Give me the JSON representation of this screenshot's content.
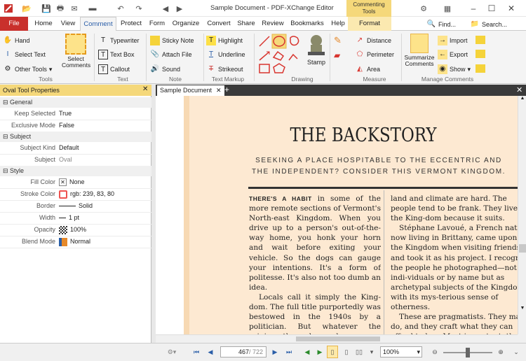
{
  "titlebar": {
    "title": "Sample Document - PDF-XChange Editor",
    "context_tab": "Commenting Tools",
    "find": "Find...",
    "search": "Search..."
  },
  "tabs": [
    "File",
    "Home",
    "View",
    "Comment",
    "Protect",
    "Form",
    "Organize",
    "Convert",
    "Share",
    "Review",
    "Bookmarks",
    "Help",
    "Format"
  ],
  "ribbon": {
    "tools": {
      "hand": "Hand",
      "select_text": "Select Text",
      "other_tools": "Other Tools",
      "select_comments": "Select Comments",
      "group": "Tools"
    },
    "text": {
      "typewriter": "Typewriter",
      "text_box": "Text Box",
      "callout": "Callout",
      "group": "Text"
    },
    "note": {
      "sticky_note": "Sticky Note",
      "attach_file": "Attach File",
      "sound": "Sound",
      "group": "Note"
    },
    "markup": {
      "highlight": "Highlight",
      "underline": "Underline",
      "strikeout": "Strikeout",
      "group": "Text Markup"
    },
    "drawing": {
      "stamp": "Stamp",
      "group": "Drawing"
    },
    "measure": {
      "distance": "Distance",
      "perimeter": "Perimeter",
      "area": "Area",
      "group": "Measure"
    },
    "manage": {
      "summarize": "Summarize Comments",
      "import": "Import",
      "export": "Export",
      "show": "Show",
      "group": "Manage Comments"
    }
  },
  "panel": {
    "title": "Oval Tool Properties",
    "sections": [
      {
        "name": "General",
        "rows": [
          {
            "label": "Keep Selected",
            "value": "True"
          },
          {
            "label": "Exclusive Mode",
            "value": "False"
          }
        ]
      },
      {
        "name": "Subject",
        "rows": [
          {
            "label": "Subject Kind",
            "value": "Default"
          },
          {
            "label": "Subject",
            "value": "Oval"
          }
        ]
      },
      {
        "name": "Style",
        "rows": [
          {
            "label": "Fill Color",
            "value": "None"
          },
          {
            "label": "Stroke Color",
            "value": "rgb: 239, 83, 80"
          },
          {
            "label": "Border",
            "value": "Solid"
          },
          {
            "label": "Width",
            "value": "1 pt"
          },
          {
            "label": "Opacity",
            "value": "100%"
          },
          {
            "label": "Blend Mode",
            "value": "Normal"
          }
        ]
      }
    ]
  },
  "doc": {
    "tab": "Sample Document",
    "headline": "THE BACKSTORY",
    "dek1": "SEEKING A PLACE HOSPITABLE TO THE ECCENTRIC AND",
    "dek2": "THE INDEPENDENT? CONSIDER THIS VERMONT KINGDOM.",
    "lead": "THERE'S A HABIT",
    "col1a": " in some of the more remote sections of Vermont's North-east Kingdom. When you drive up to a person's out-of-the-way home, you honk your horn and wait before exiting your vehicle. So the dogs can gauge your intentions. It's a form of politesse. It's also not too dumb an idea.",
    "col1b": "Locals call it simply the King-dom. The full title purportedly was bestowed in the 1940s by a politician. But whatever the origin, the place deserves a special label. Even in a state as different, occasionally ornery, and",
    "col2a": "land and climate are hard. The people tend to be frank. They live in the King-dom because it suits.",
    "col2b": "Stéphane Lavoué, a French native now living in Brittany, came upon the Kingdom when visiting friends and took it as his project. I recognize the people he photographed—not as indi-viduals or by name but as archetypal subjects of the Kingdom with its mys-terious sense of otherness.",
    "col2c": "These are pragmatists. They make do, and they craft what they can afford to buy. Most important, the"
  },
  "status": {
    "page_current": "467",
    "page_total": "/ 722",
    "zoom": "100%"
  },
  "colors": {
    "stroke": "#ef5350",
    "file_tab": "#c9302c",
    "accent": "#f5d87a",
    "page": "#fde9d2"
  }
}
